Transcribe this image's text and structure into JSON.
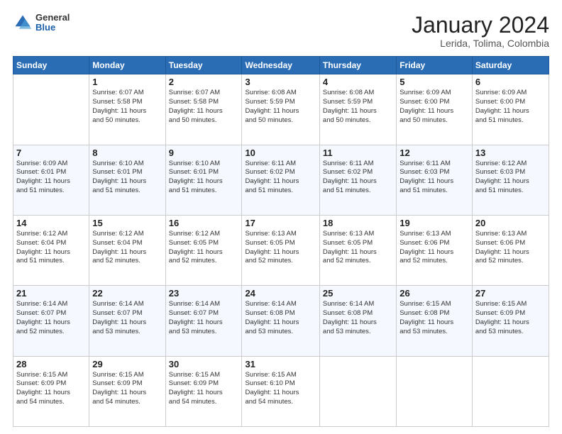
{
  "header": {
    "logo": {
      "general": "General",
      "blue": "Blue"
    },
    "title": "January 2024",
    "subtitle": "Lerida, Tolima, Colombia"
  },
  "calendar": {
    "headers": [
      "Sunday",
      "Monday",
      "Tuesday",
      "Wednesday",
      "Thursday",
      "Friday",
      "Saturday"
    ],
    "weeks": [
      [
        {
          "day": "",
          "info": ""
        },
        {
          "day": "1",
          "info": "Sunrise: 6:07 AM\nSunset: 5:58 PM\nDaylight: 11 hours\nand 50 minutes."
        },
        {
          "day": "2",
          "info": "Sunrise: 6:07 AM\nSunset: 5:58 PM\nDaylight: 11 hours\nand 50 minutes."
        },
        {
          "day": "3",
          "info": "Sunrise: 6:08 AM\nSunset: 5:59 PM\nDaylight: 11 hours\nand 50 minutes."
        },
        {
          "day": "4",
          "info": "Sunrise: 6:08 AM\nSunset: 5:59 PM\nDaylight: 11 hours\nand 50 minutes."
        },
        {
          "day": "5",
          "info": "Sunrise: 6:09 AM\nSunset: 6:00 PM\nDaylight: 11 hours\nand 50 minutes."
        },
        {
          "day": "6",
          "info": "Sunrise: 6:09 AM\nSunset: 6:00 PM\nDaylight: 11 hours\nand 51 minutes."
        }
      ],
      [
        {
          "day": "7",
          "info": "Sunrise: 6:09 AM\nSunset: 6:01 PM\nDaylight: 11 hours\nand 51 minutes."
        },
        {
          "day": "8",
          "info": "Sunrise: 6:10 AM\nSunset: 6:01 PM\nDaylight: 11 hours\nand 51 minutes."
        },
        {
          "day": "9",
          "info": "Sunrise: 6:10 AM\nSunset: 6:01 PM\nDaylight: 11 hours\nand 51 minutes."
        },
        {
          "day": "10",
          "info": "Sunrise: 6:11 AM\nSunset: 6:02 PM\nDaylight: 11 hours\nand 51 minutes."
        },
        {
          "day": "11",
          "info": "Sunrise: 6:11 AM\nSunset: 6:02 PM\nDaylight: 11 hours\nand 51 minutes."
        },
        {
          "day": "12",
          "info": "Sunrise: 6:11 AM\nSunset: 6:03 PM\nDaylight: 11 hours\nand 51 minutes."
        },
        {
          "day": "13",
          "info": "Sunrise: 6:12 AM\nSunset: 6:03 PM\nDaylight: 11 hours\nand 51 minutes."
        }
      ],
      [
        {
          "day": "14",
          "info": "Sunrise: 6:12 AM\nSunset: 6:04 PM\nDaylight: 11 hours\nand 51 minutes."
        },
        {
          "day": "15",
          "info": "Sunrise: 6:12 AM\nSunset: 6:04 PM\nDaylight: 11 hours\nand 52 minutes."
        },
        {
          "day": "16",
          "info": "Sunrise: 6:12 AM\nSunset: 6:05 PM\nDaylight: 11 hours\nand 52 minutes."
        },
        {
          "day": "17",
          "info": "Sunrise: 6:13 AM\nSunset: 6:05 PM\nDaylight: 11 hours\nand 52 minutes."
        },
        {
          "day": "18",
          "info": "Sunrise: 6:13 AM\nSunset: 6:05 PM\nDaylight: 11 hours\nand 52 minutes."
        },
        {
          "day": "19",
          "info": "Sunrise: 6:13 AM\nSunset: 6:06 PM\nDaylight: 11 hours\nand 52 minutes."
        },
        {
          "day": "20",
          "info": "Sunrise: 6:13 AM\nSunset: 6:06 PM\nDaylight: 11 hours\nand 52 minutes."
        }
      ],
      [
        {
          "day": "21",
          "info": "Sunrise: 6:14 AM\nSunset: 6:07 PM\nDaylight: 11 hours\nand 52 minutes."
        },
        {
          "day": "22",
          "info": "Sunrise: 6:14 AM\nSunset: 6:07 PM\nDaylight: 11 hours\nand 53 minutes."
        },
        {
          "day": "23",
          "info": "Sunrise: 6:14 AM\nSunset: 6:07 PM\nDaylight: 11 hours\nand 53 minutes."
        },
        {
          "day": "24",
          "info": "Sunrise: 6:14 AM\nSunset: 6:08 PM\nDaylight: 11 hours\nand 53 minutes."
        },
        {
          "day": "25",
          "info": "Sunrise: 6:14 AM\nSunset: 6:08 PM\nDaylight: 11 hours\nand 53 minutes."
        },
        {
          "day": "26",
          "info": "Sunrise: 6:15 AM\nSunset: 6:08 PM\nDaylight: 11 hours\nand 53 minutes."
        },
        {
          "day": "27",
          "info": "Sunrise: 6:15 AM\nSunset: 6:09 PM\nDaylight: 11 hours\nand 53 minutes."
        }
      ],
      [
        {
          "day": "28",
          "info": "Sunrise: 6:15 AM\nSunset: 6:09 PM\nDaylight: 11 hours\nand 54 minutes."
        },
        {
          "day": "29",
          "info": "Sunrise: 6:15 AM\nSunset: 6:09 PM\nDaylight: 11 hours\nand 54 minutes."
        },
        {
          "day": "30",
          "info": "Sunrise: 6:15 AM\nSunset: 6:09 PM\nDaylight: 11 hours\nand 54 minutes."
        },
        {
          "day": "31",
          "info": "Sunrise: 6:15 AM\nSunset: 6:10 PM\nDaylight: 11 hours\nand 54 minutes."
        },
        {
          "day": "",
          "info": ""
        },
        {
          "day": "",
          "info": ""
        },
        {
          "day": "",
          "info": ""
        }
      ]
    ]
  }
}
